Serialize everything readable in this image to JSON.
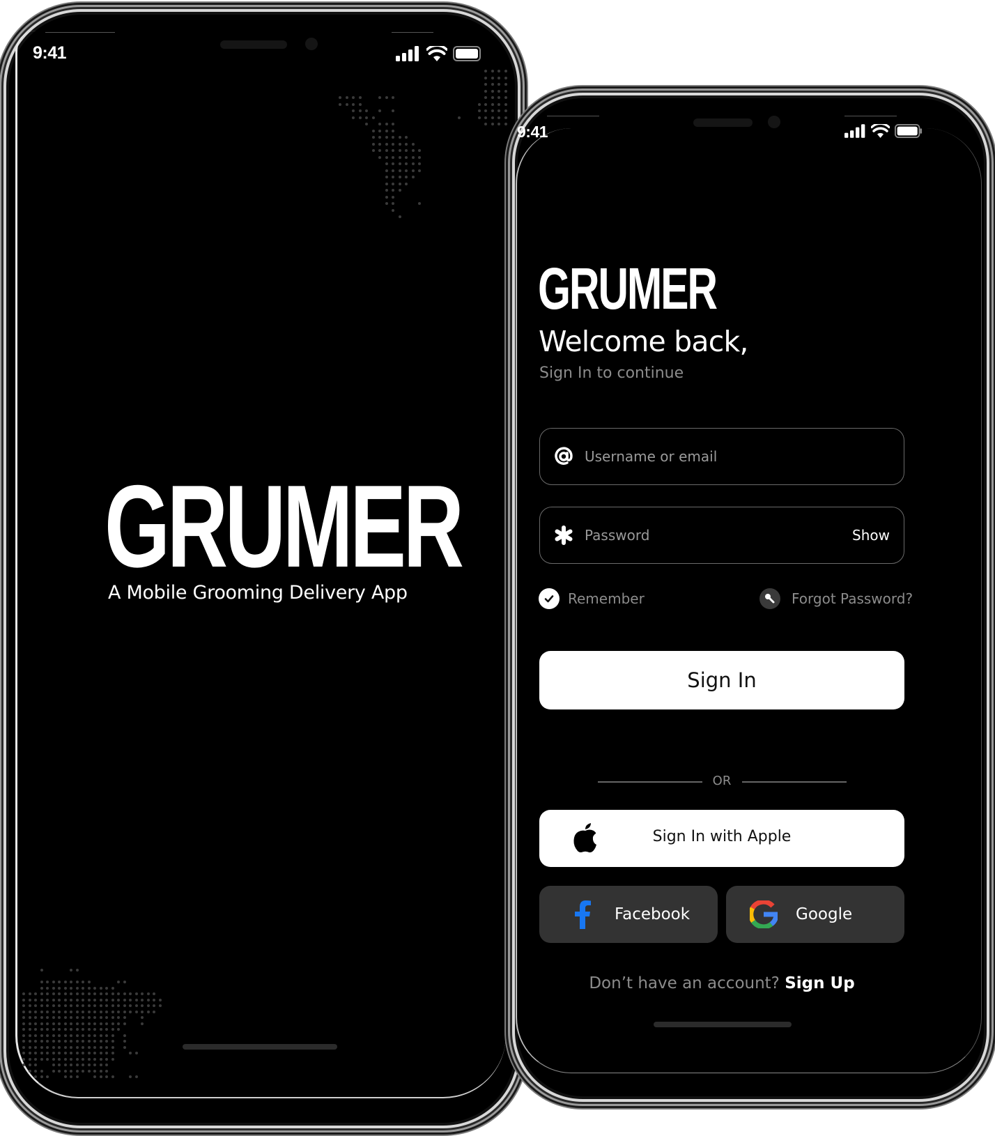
{
  "splash_screen": {
    "status_bar": {
      "time": "9:41",
      "icons": [
        "cellular-signal-icon",
        "wifi-icon",
        "battery-icon"
      ]
    },
    "brand": "GRUMER",
    "tagline": "A Mobile Grooming Delivery App",
    "background_decoration": "dotted-world-map"
  },
  "login_screen": {
    "status_bar": {
      "time": "9:41",
      "icons": [
        "cellular-signal-icon",
        "wifi-icon",
        "battery-icon"
      ]
    },
    "brand": "GRUMER",
    "heading": "Welcome back,",
    "subheading": "Sign In to continue",
    "username_field": {
      "icon": "at-sign-icon",
      "placeholder": "Username or email",
      "value": ""
    },
    "password_field": {
      "icon": "asterisk-icon",
      "placeholder": "Password",
      "value": "",
      "toggle_label": "Show"
    },
    "remember": {
      "label": "Remember",
      "checked": true,
      "icon": "check-circle-icon"
    },
    "forgot_password": {
      "label": "Forgot Password?",
      "icon": "key-icon"
    },
    "sign_in_button": "Sign In",
    "divider_label": "OR",
    "apple_button": {
      "label": "Sign In with Apple",
      "icon": "apple-icon"
    },
    "facebook_button": {
      "label": "Facebook",
      "icon": "facebook-icon",
      "color": "#1877F2"
    },
    "google_button": {
      "label": "Google",
      "icon": "google-icon",
      "colors": [
        "#EA4335",
        "#FBBC05",
        "#34A853",
        "#4285F4"
      ]
    },
    "signup_prompt": {
      "text": "Don’t have an account?",
      "link": "Sign Up"
    }
  },
  "colors": {
    "background": "#000000",
    "primary_button": "#FFFFFF",
    "social_button": "#333333",
    "muted_text": "#8C8C8C",
    "field_border": "#6B6B6B"
  }
}
